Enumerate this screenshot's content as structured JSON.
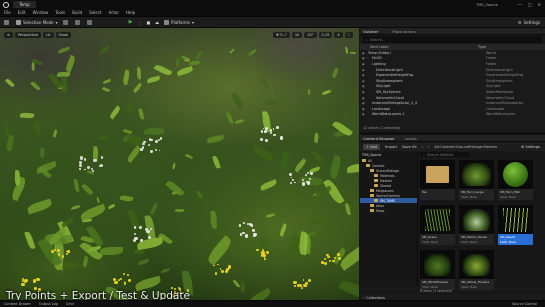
{
  "window": {
    "project_tab": "Temp",
    "right_title": "TMS_Source",
    "controls": [
      "—",
      "□",
      "✕"
    ]
  },
  "menu": [
    "File",
    "Edit",
    "Window",
    "Tools",
    "Build",
    "Select",
    "Actor",
    "Help"
  ],
  "toolbar": {
    "mode_label": "Selection Mode",
    "platforms_label": "Platforms",
    "settings_label": "Settings"
  },
  "viewport": {
    "perspective_label": "Perspective",
    "lit_label": "Lit",
    "show_label": "Show",
    "grid_value": "10",
    "rotation_value": "10°",
    "scale_value": "0.25",
    "camera_value": "4",
    "caption": "Try Points + Export / Test & Update"
  },
  "outliner": {
    "tab_label": "Outliner",
    "second_tab": "Place Actors",
    "search_placeholder": "Search...",
    "col_label": "Item Label",
    "col_type": "Type",
    "rows": [
      {
        "label": "Temp (Editor)",
        "type": "World",
        "indent": 0,
        "selected": false
      },
      {
        "label": "HLOD",
        "type": "Folder",
        "indent": 1,
        "selected": false
      },
      {
        "label": "Lighting",
        "type": "Folder",
        "indent": 1,
        "selected": false
      },
      {
        "label": "DirectionalLight",
        "type": "DirectionalLight",
        "indent": 2,
        "selected": false
      },
      {
        "label": "ExponentialHeightFog",
        "type": "ExponentialHeightFog",
        "indent": 2,
        "selected": false
      },
      {
        "label": "SkyAtmosphere",
        "type": "SkyAtmosphere",
        "indent": 2,
        "selected": false
      },
      {
        "label": "SkyLight",
        "type": "SkyLight",
        "indent": 2,
        "selected": false
      },
      {
        "label": "SM_SkySphere",
        "type": "StaticMeshActor",
        "indent": 2,
        "selected": false
      },
      {
        "label": "VolumetricCloud",
        "type": "VolumetricCloud",
        "indent": 2,
        "selected": false
      },
      {
        "label": "InstancedFoliageActor_2_0",
        "type": "InstancedFoliageActor",
        "indent": 1,
        "selected": false
      },
      {
        "label": "Landscape",
        "type": "Landscape",
        "indent": 1,
        "selected": false
      },
      {
        "label": "WorldDataLayers-1",
        "type": "WorldDataLayers",
        "indent": 1,
        "selected": false
      }
    ],
    "footer": "12 actors (1 selected)"
  },
  "content_browser": {
    "tab_label": "Content Browser",
    "second_tab": "Levels",
    "add_label": "+ Add",
    "import_label": "Import",
    "save_all_label": "Save All",
    "breadcrumb": [
      "All",
      "Content",
      "GroundFoliage",
      "Meshes"
    ],
    "settings_label": "Settings",
    "search_placeholder": "Search Meshes",
    "tree_root": "TMS_Source",
    "tree": [
      {
        "label": "All",
        "indent": 0,
        "selected": false
      },
      {
        "label": "Content",
        "indent": 1,
        "selected": false
      },
      {
        "label": "GroundFoliage",
        "indent": 2,
        "selected": false
      },
      {
        "label": "Materials",
        "indent": 3,
        "selected": false
      },
      {
        "label": "Meshes",
        "indent": 3,
        "selected": false
      },
      {
        "label": "Shared",
        "indent": 3,
        "selected": false
      },
      {
        "label": "Megascans",
        "indent": 2,
        "selected": false
      },
      {
        "label": "StarterContent",
        "indent": 2,
        "selected": false
      },
      {
        "label": "SM_TAMS",
        "indent": 3,
        "selected": true
      },
      {
        "label": "Atlas",
        "indent": 2,
        "selected": false
      },
      {
        "label": "Maps",
        "indent": 2,
        "selected": false
      }
    ],
    "items": [
      {
        "name": "Tex",
        "kind": "",
        "thumb": "folder",
        "selected": false
      },
      {
        "name": "SM_Fern_Large",
        "kind": "Static Mesh",
        "thumb": "fern",
        "selected": false
      },
      {
        "name": "SM_Fern_Mini",
        "kind": "Static Mesh",
        "thumb": "sphere",
        "selected": false
      },
      {
        "name": "SM_Grass",
        "kind": "Static Mesh",
        "thumb": "grass",
        "selected": false
      },
      {
        "name": "SM_Plants_Dense",
        "kind": "Static Mesh",
        "thumb": "dense",
        "selected": false
      },
      {
        "name": "SM_Reeds",
        "kind": "Static Mesh",
        "thumb": "reeds",
        "selected": true
      },
      {
        "name": "SM_WhiteFlowers",
        "kind": "Static Mesh",
        "thumb": "flowers",
        "selected": false
      },
      {
        "name": "SM_Yellow_Flowers",
        "kind": "Static Mesh",
        "thumb": "yflowers",
        "selected": false
      }
    ],
    "footer": "8 items (1 selected)"
  },
  "collections_label": "Collections",
  "statusbar": {
    "content_drawer": "Content Drawer",
    "output_log": "Output Log",
    "cmd": "Cmd",
    "source_control": "Source Control"
  },
  "colors": {
    "accent": "#2a6fd6",
    "panel": "#1a1a1a",
    "folder": "#c9a35c",
    "play_green": "#3fbf3f"
  }
}
